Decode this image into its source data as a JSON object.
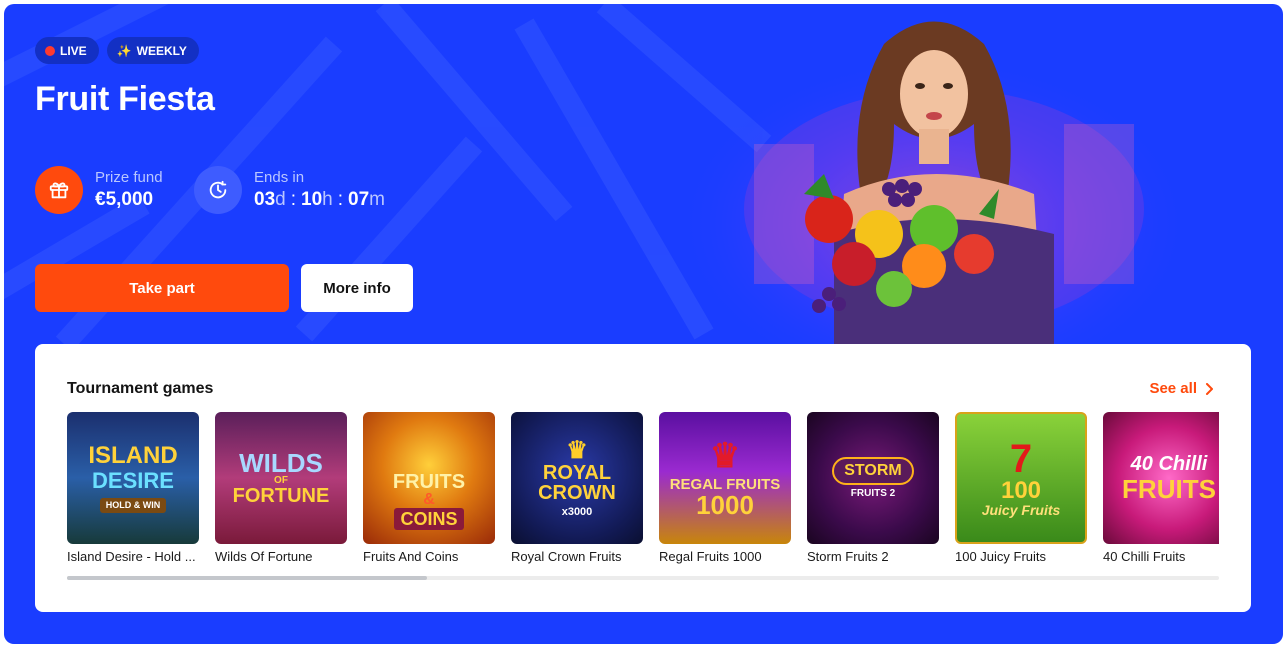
{
  "tournament": {
    "badges": {
      "live": "LIVE",
      "weekly": "WEEKLY"
    },
    "title": "Fruit Fiesta",
    "prize": {
      "label": "Prize fund",
      "value": "€5,000",
      "icon": "gift-icon"
    },
    "timer": {
      "label": "Ends in",
      "days": "03",
      "days_unit": "d",
      "hours": "10",
      "hours_unit": "h",
      "minutes": "07",
      "minutes_unit": "m",
      "separator": ":",
      "icon": "clock-icon"
    },
    "buttons": {
      "take_part": "Take part",
      "more_info": "More info"
    }
  },
  "games_section": {
    "title": "Tournament games",
    "see_all": "See all",
    "games": [
      {
        "name": "Island Desire - Hold ...",
        "art_title": "ISLAND",
        "art_sub": "DESIRE",
        "art_tag": "HOLD & WIN"
      },
      {
        "name": "Wilds Of Fortune",
        "art_title": "WILDS",
        "art_sub": "FORTUNE",
        "art_tag": "OF"
      },
      {
        "name": "Fruits And Coins",
        "art_title": "FRUITS",
        "art_sub": "COINS",
        "art_tag": "&"
      },
      {
        "name": "Royal Crown Fruits",
        "art_title": "ROYAL",
        "art_sub": "CROWN",
        "art_tag": "x3000"
      },
      {
        "name": "Regal Fruits 1000",
        "art_title": "REGAL FRUITS",
        "art_sub": "1000",
        "art_tag": ""
      },
      {
        "name": "Storm Fruits 2",
        "art_title": "STORM",
        "art_sub": "FRUITS 2",
        "art_tag": ""
      },
      {
        "name": "100 Juicy Fruits",
        "art_title": "100",
        "art_sub": "Juicy Fruits",
        "art_tag": "7"
      },
      {
        "name": "40 Chilli Fruits",
        "art_title": "40 Chilli",
        "art_sub": "FRUITS",
        "art_tag": ""
      }
    ]
  },
  "colors": {
    "banner_blue": "#1a3dff",
    "accent_orange": "#ff4a0d",
    "live_red": "#ff3a2e"
  }
}
